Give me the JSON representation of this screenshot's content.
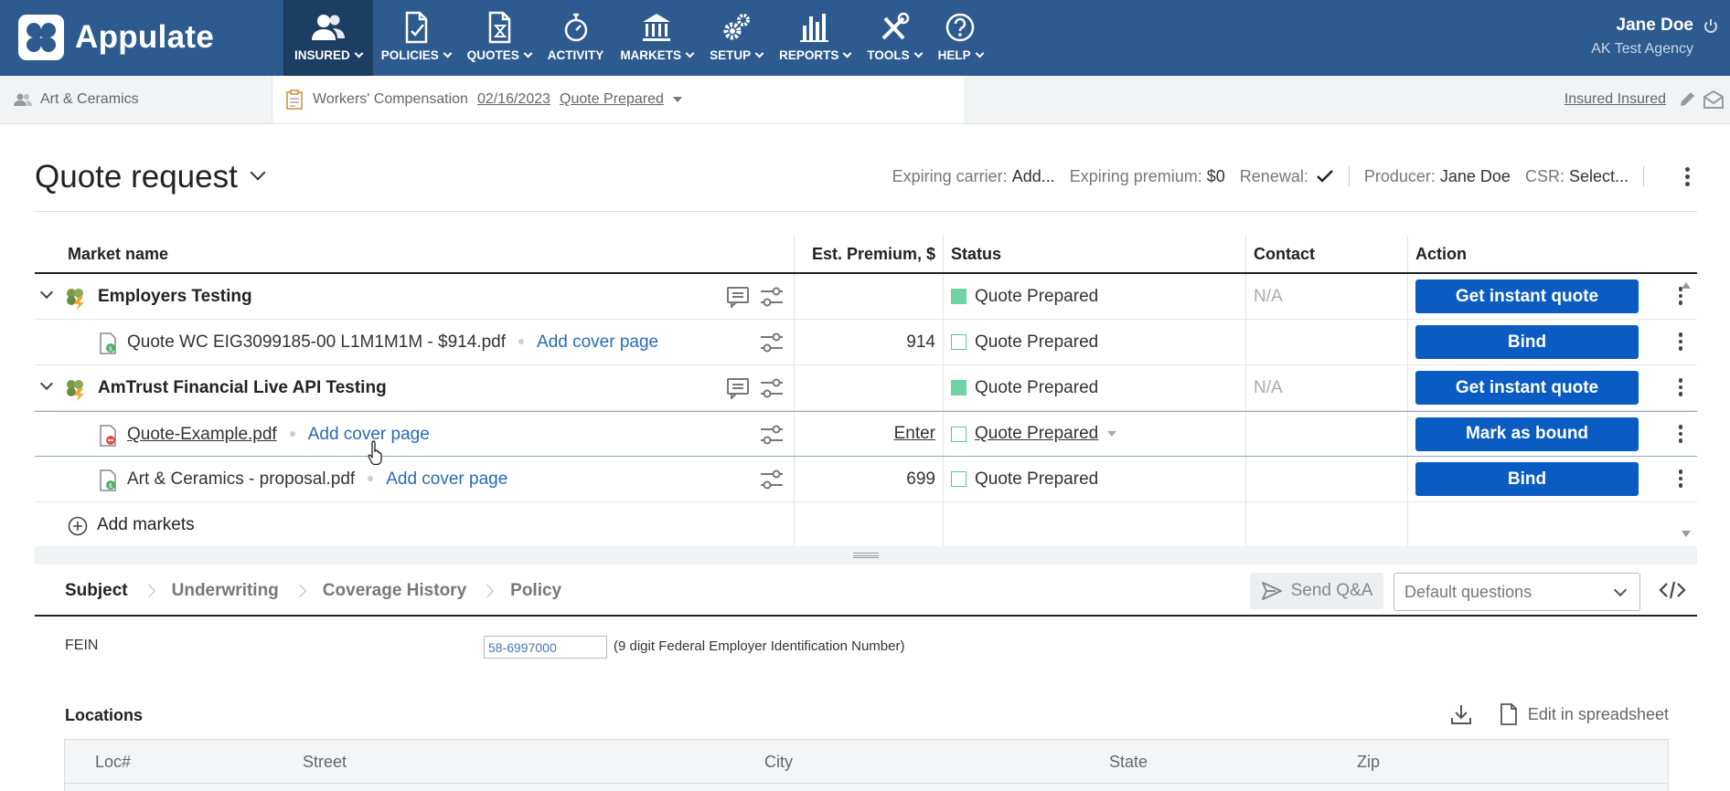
{
  "app": {
    "name": "Appulate"
  },
  "nav": [
    {
      "label": "INSURED",
      "active": true
    },
    {
      "label": "POLICIES"
    },
    {
      "label": "QUOTES"
    },
    {
      "label": "ACTIVITY"
    },
    {
      "label": "MARKETS"
    },
    {
      "label": "SETUP"
    },
    {
      "label": "REPORTS"
    },
    {
      "label": "TOOLS"
    },
    {
      "label": "HELP"
    }
  ],
  "user": {
    "name": "Jane Doe",
    "agency": "AK Test Agency"
  },
  "context": {
    "insured": "Art & Ceramics",
    "policy_type": "Workers' Compensation",
    "date": "02/16/2023",
    "status": "Quote Prepared",
    "insured_link": "Insured Insured"
  },
  "quote": {
    "title": "Quote request",
    "expiring_carrier_label": "Expiring carrier:",
    "expiring_carrier_value": "Add...",
    "expiring_premium_label": "Expiring premium:",
    "expiring_premium_value": "$0",
    "renewal_label": "Renewal:",
    "producer_label": "Producer:",
    "producer_value": "Jane Doe",
    "csr_label": "CSR:",
    "csr_value": "Select..."
  },
  "table": {
    "headers": {
      "market": "Market name",
      "premium": "Est. Premium, $",
      "status": "Status",
      "contact": "Contact",
      "action": "Action"
    },
    "rows": [
      {
        "name": "Employers Testing",
        "status": "Quote Prepared",
        "contact": "N/A",
        "action": "Get instant quote"
      },
      {
        "file": "Quote WC EIG3099185-00 L1M1M1M - $914.pdf",
        "cover": "Add cover page",
        "premium": "914",
        "status": "Quote Prepared",
        "action": "Bind"
      },
      {
        "name": "AmTrust Financial Live API Testing",
        "status": "Quote Prepared",
        "contact": "N/A",
        "action": "Get instant quote"
      },
      {
        "file": "Quote-Example.pdf",
        "cover": "Add cover page",
        "premium": "Enter",
        "status": "Quote Prepared",
        "action": "Mark as bound"
      },
      {
        "file": "Art & Ceramics - proposal.pdf",
        "cover": "Add cover page",
        "premium": "699",
        "status": "Quote Prepared",
        "action": "Bind"
      }
    ],
    "add_markets": "Add markets"
  },
  "qa": {
    "tabs": [
      "Subject",
      "Underwriting",
      "Coverage History",
      "Policy"
    ],
    "send_label": "Send Q&A",
    "questions_select": "Default questions"
  },
  "fein": {
    "label": "FEIN",
    "value": "58-6997000",
    "hint": "(9 digit Federal Employer Identification Number)"
  },
  "locations": {
    "title": "Locations",
    "edit_label": "Edit in spreadsheet",
    "columns": [
      "Loc#",
      "Street",
      "City",
      "State",
      "Zip"
    ]
  },
  "colors": {
    "nav_bg": "#2e5b8f",
    "nav_active": "#1c3e63",
    "button_blue": "#0a5cc2",
    "status_green": "#6fd3a3",
    "link_blue": "#2a6ab7"
  }
}
